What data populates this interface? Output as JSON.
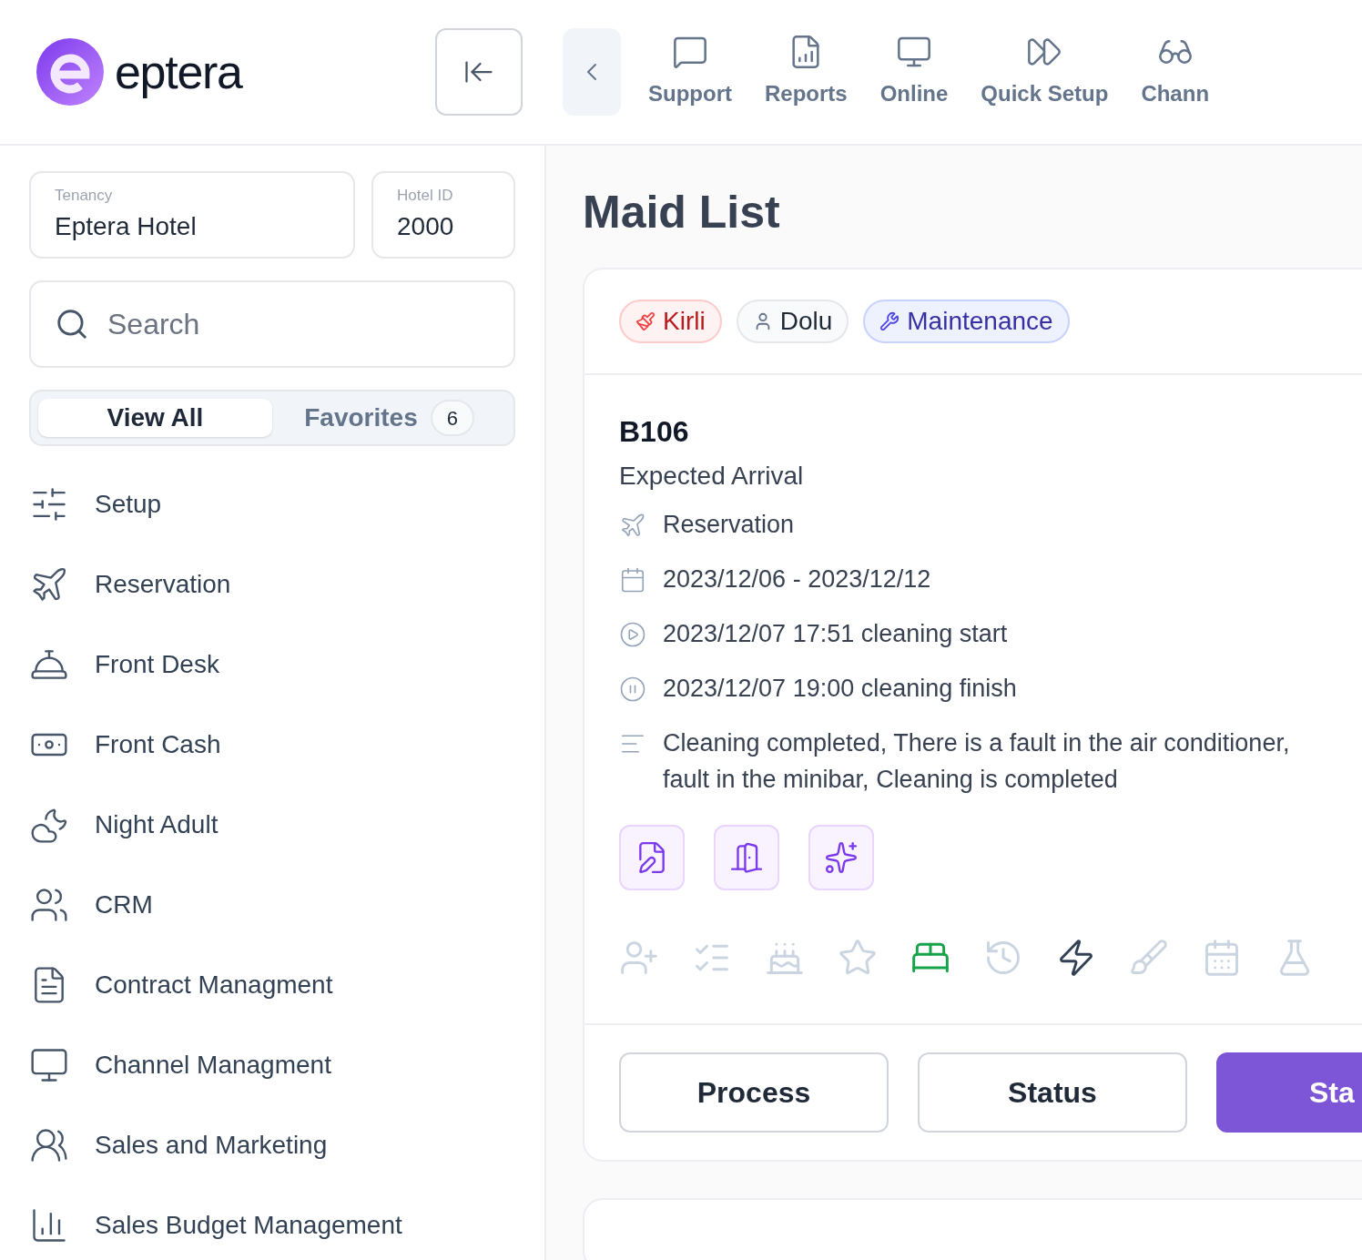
{
  "brand": {
    "name": "eptera"
  },
  "top_nav": [
    {
      "label": "Support"
    },
    {
      "label": "Reports"
    },
    {
      "label": "Online"
    },
    {
      "label": "Quick Setup"
    },
    {
      "label": "Chann"
    }
  ],
  "sidebar": {
    "tenancy": {
      "label": "Tenancy",
      "value": "Eptera Hotel"
    },
    "hotel_id": {
      "label": "Hotel ID",
      "value": "2000"
    },
    "search": {
      "placeholder": "Search"
    },
    "tabs": [
      {
        "label": "View All",
        "selected": true
      },
      {
        "label": "Favorites",
        "count": "6",
        "selected": false
      }
    ],
    "items": [
      {
        "label": "Setup"
      },
      {
        "label": "Reservation"
      },
      {
        "label": "Front Desk"
      },
      {
        "label": "Front Cash"
      },
      {
        "label": "Night Adult"
      },
      {
        "label": "CRM"
      },
      {
        "label": "Contract Managment"
      },
      {
        "label": "Channel Managment"
      },
      {
        "label": "Sales and Marketing"
      },
      {
        "label": "Sales Budget Management"
      }
    ]
  },
  "page": {
    "title": "Maid List"
  },
  "card": {
    "tags": [
      {
        "label": "Kirli",
        "kind": "dirty"
      },
      {
        "label": "Dolu",
        "kind": "occupied"
      },
      {
        "label": "Maintenance",
        "kind": "maintenance"
      }
    ],
    "room": "B106",
    "subtitle": "Expected Arrival",
    "details": [
      {
        "kind": "reservation",
        "text": "Reservation"
      },
      {
        "kind": "dates",
        "text": "2023/12/06 - 2023/12/12"
      },
      {
        "kind": "start",
        "text": "2023/12/07 17:51 cleaning start"
      },
      {
        "kind": "finish",
        "text": "2023/12/07 19:00 cleaning finish"
      },
      {
        "kind": "note",
        "text": "Cleaning completed, There is a fault in the air conditioner, fault in the minibar, Cleaning is completed"
      }
    ],
    "feature_icons": [
      {
        "color": "#cbd5e1"
      },
      {
        "color": "#cbd5e1"
      },
      {
        "color": "#cbd5e1"
      },
      {
        "color": "#cbd5e1"
      },
      {
        "color": "#16a34a"
      },
      {
        "color": "#cbd5e1"
      },
      {
        "color": "#334155"
      },
      {
        "color": "#cbd5e1"
      },
      {
        "color": "#cbd5e1"
      },
      {
        "color": "#cbd5e1"
      }
    ],
    "buttons": [
      {
        "label": "Process",
        "kind": "outline"
      },
      {
        "label": "Status",
        "kind": "outline"
      },
      {
        "label": "Sta",
        "kind": "primary"
      }
    ]
  }
}
